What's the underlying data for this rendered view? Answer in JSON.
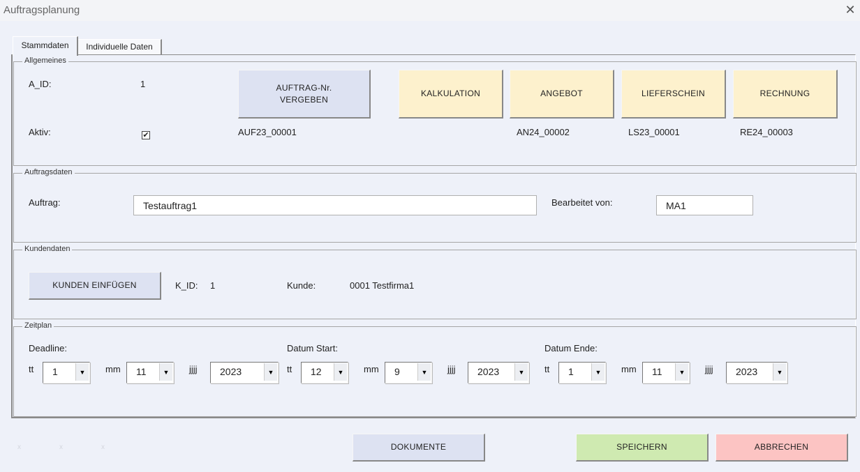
{
  "window": {
    "title": "Auftragsplanung",
    "close_glyph": "✕"
  },
  "tabs": [
    {
      "label": "Stammdaten",
      "active": true
    },
    {
      "label": "Individuelle Daten",
      "active": false
    }
  ],
  "allgemeines": {
    "legend": "Allgemeines",
    "a_id_label": "A_ID:",
    "a_id_value": "1",
    "aktiv_label": "Aktiv:",
    "aktiv_checked": true,
    "auftrag_nr_button": "AUFTRAG-Nr. VERGEBEN",
    "auftrag_nr_line1": "AUFTRAG-Nr.",
    "auftrag_nr_line2": "VERGEBEN",
    "auftrag_nr_value": "AUF23_00001",
    "kalkulation_button": "KALKULATION",
    "angebot_button": "ANGEBOT",
    "angebot_value": "AN24_00002",
    "lieferschein_button": "LIEFERSCHEIN",
    "lieferschein_value": "LS23_00001",
    "rechnung_button": "RECHNUNG",
    "rechnung_value": "RE24_00003"
  },
  "auftragsdaten": {
    "legend": "Auftragsdaten",
    "auftrag_label": "Auftrag:",
    "auftrag_value": "Testauftrag1",
    "bearbeitet_label": "Bearbeitet von:",
    "bearbeitet_value": "MA1"
  },
  "kundendaten": {
    "legend": "Kundendaten",
    "kunden_button": "KUNDEN EINFÜGEN",
    "k_id_label": "K_ID:",
    "k_id_value": "1",
    "kunde_label": "Kunde:",
    "kunde_value": "0001 Testfirma1"
  },
  "zeitplan": {
    "legend": "Zeitplan",
    "tt_label": "tt",
    "mm_label": "mm",
    "jjjj_label": "jjjj",
    "deadline": {
      "label": "Deadline:",
      "tt": "1",
      "mm": "11",
      "jjjj": "2023"
    },
    "start": {
      "label": "Datum Start:",
      "tt": "12",
      "mm": "9",
      "jjjj": "2023"
    },
    "ende": {
      "label": "Datum Ende:",
      "tt": "1",
      "mm": "11",
      "jjjj": "2023"
    }
  },
  "footer": {
    "faint_marks": [
      "x",
      "x",
      "x"
    ],
    "dokumente_button": "DOKUMENTE",
    "speichern_button": "SPEICHERN",
    "abbrechen_button": "ABBRECHEN"
  },
  "colors": {
    "blue_button": "#dde2f2",
    "yellow_button": "#fdf1cd",
    "green_button": "#cfeab1",
    "red_button": "#fcc4c3",
    "form_background": "#eef1f9"
  },
  "icons": {
    "dropdown_arrow": "▼",
    "check": "✔"
  }
}
